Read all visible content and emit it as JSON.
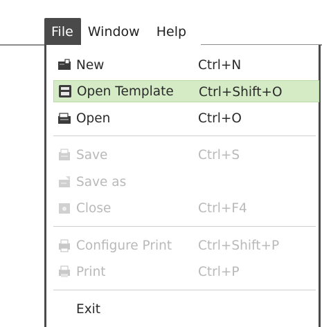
{
  "menubar": {
    "file": "File",
    "window": "Window",
    "help": "Help"
  },
  "file_menu": {
    "new": {
      "label": "New",
      "shortcut": "Ctrl+N",
      "icon": "new-document-icon"
    },
    "open_template": {
      "label": "Open Template",
      "shortcut": "Ctrl+Shift+O",
      "icon": "template-icon"
    },
    "open": {
      "label": "Open",
      "shortcut": "Ctrl+O",
      "icon": "open-folder-icon"
    },
    "save": {
      "label": "Save",
      "shortcut": "Ctrl+S",
      "icon": "save-icon"
    },
    "save_as": {
      "label": "Save as",
      "icon": "save-as-icon"
    },
    "close": {
      "label": "Close",
      "shortcut": "Ctrl+F4",
      "icon": "close-document-icon"
    },
    "configure_print": {
      "label": "Configure Print",
      "shortcut": "Ctrl+Shift+P",
      "icon": "print-settings-icon"
    },
    "print": {
      "label": "Print",
      "shortcut": "Ctrl+P",
      "icon": "printer-icon"
    },
    "exit": {
      "label": "Exit"
    }
  },
  "colors": {
    "active_menu_bg": "#4a4a4a",
    "hover_bg": "#d4ebc6",
    "disabled_text": "#b9b9b9"
  }
}
